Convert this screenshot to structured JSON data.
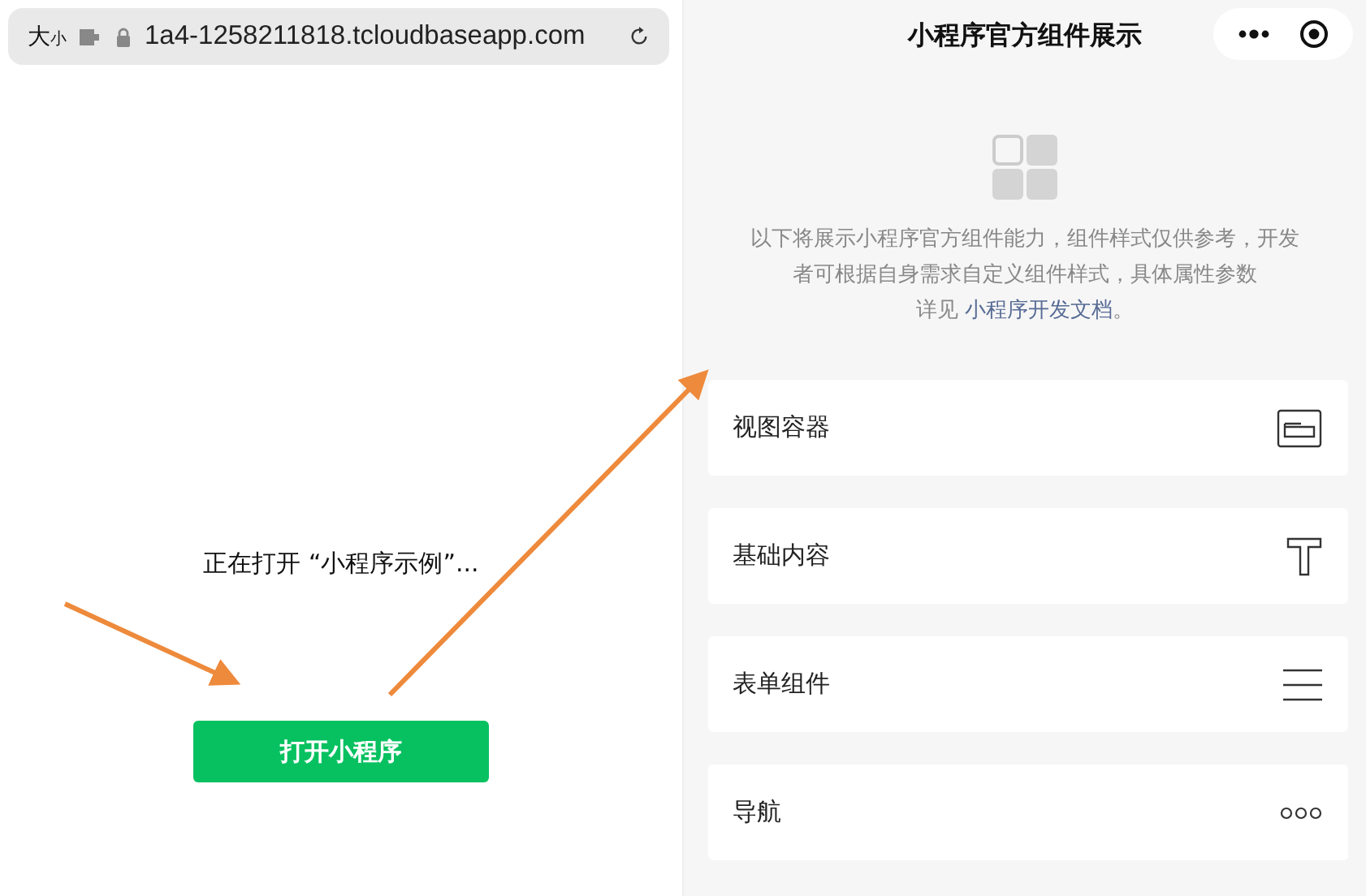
{
  "browser": {
    "text_size": {
      "large": "大",
      "small": "小"
    },
    "url": "1a4-1258211818.tcloudbaseapp.com"
  },
  "opening": {
    "message": "正在打开 “小程序示例”...",
    "button": "打开小程序"
  },
  "mini_program": {
    "title": "小程序官方组件展示",
    "intro": "以下将展示小程序官方组件能力，组件样式仅供参考，开发者可根据自身需求自定义组件样式，具体属性参数",
    "intro_prefix": "详见",
    "doc_link": "小程序开发文档",
    "intro_suffix": "。",
    "items": [
      {
        "label": "视图容器",
        "kind": "view"
      },
      {
        "label": "基础内容",
        "kind": "text"
      },
      {
        "label": "表单组件",
        "kind": "form"
      },
      {
        "label": "导航",
        "kind": "nav"
      }
    ]
  }
}
